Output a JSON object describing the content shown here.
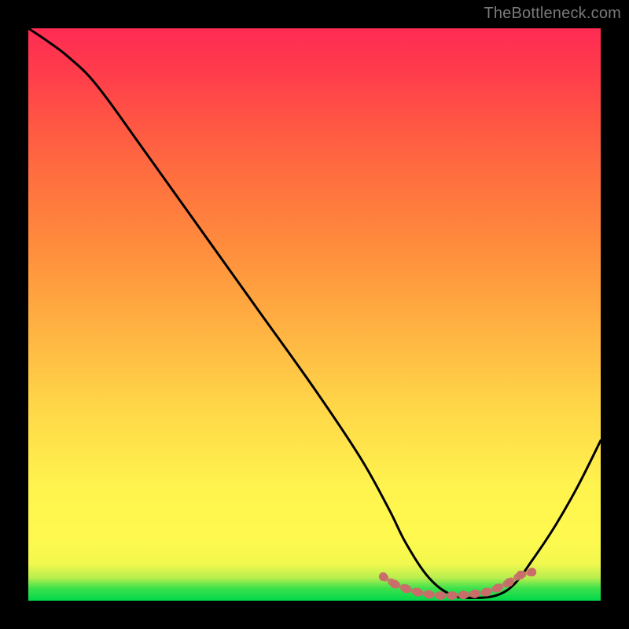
{
  "watermark": "TheBottleneck.com",
  "chart_data": {
    "type": "line",
    "title": "",
    "xlabel": "",
    "ylabel": "",
    "xlim": [
      0,
      100
    ],
    "ylim": [
      0,
      100
    ],
    "grid": false,
    "legend": false,
    "series": [
      {
        "name": "curve",
        "color": "#000000",
        "x": [
          0,
          3,
          7,
          12,
          20,
          30,
          40,
          50,
          58,
          63,
          66,
          70,
          74,
          78,
          82,
          85,
          88,
          92,
          96,
          100
        ],
        "values": [
          100,
          98,
          95,
          90,
          79,
          65,
          51,
          37,
          25,
          16,
          10,
          4,
          1,
          0.5,
          1,
          3,
          7,
          13,
          20,
          28
        ]
      },
      {
        "name": "dotted-band",
        "color": "#c96d6a",
        "style": "dotted",
        "x": [
          62,
          64,
          66,
          68,
          70,
          72,
          74,
          76,
          78,
          80,
          82,
          84,
          86,
          88
        ],
        "values": [
          4.2,
          2.9,
          2.1,
          1.5,
          1.1,
          0.9,
          0.9,
          1.0,
          1.2,
          1.5,
          2.2,
          3.2,
          4.5,
          5.0
        ]
      }
    ],
    "gradient_bands": {
      "description": "vertical gradient from green (bottom) through yellow/orange to red (top)",
      "stops_percent_from_bottom": {
        "0": "#00d84a",
        "4": "#b8ee4e",
        "11": "#fff94f",
        "34": "#ffd648",
        "62": "#ff8c3d",
        "84": "#ff5544",
        "100": "#ff2b53"
      }
    }
  }
}
